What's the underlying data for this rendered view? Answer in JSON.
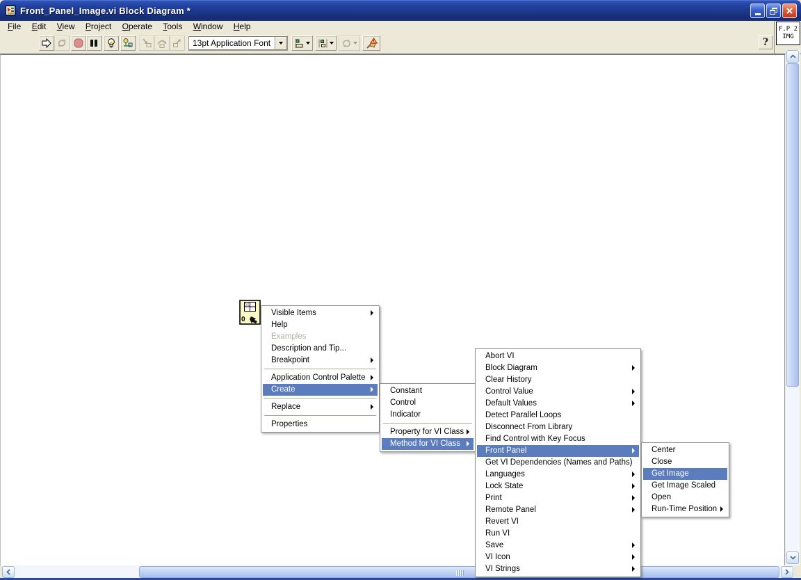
{
  "window": {
    "title": "Front_Panel_Image.vi Block Diagram *"
  },
  "vi_icon": {
    "line1": "F.P 2",
    "line2": "IMG"
  },
  "menu_bar": {
    "items": [
      {
        "label": "File"
      },
      {
        "label": "Edit"
      },
      {
        "label": "View"
      },
      {
        "label": "Project"
      },
      {
        "label": "Operate"
      },
      {
        "label": "Tools"
      },
      {
        "label": "Window"
      },
      {
        "label": "Help"
      }
    ]
  },
  "toolbar": {
    "font_selector": {
      "value": "13pt Application Font"
    },
    "buttons": [
      {
        "name": "run"
      },
      {
        "name": "run-continuously",
        "disabled": true
      },
      {
        "name": "abort-execution",
        "disabled": true
      },
      {
        "name": "pause"
      },
      {
        "name": "highlight-execution"
      },
      {
        "name": "retain-wire-values"
      },
      {
        "name": "step-into",
        "disabled": true
      },
      {
        "name": "step-over",
        "disabled": true
      },
      {
        "name": "step-out",
        "disabled": true
      },
      {
        "name": "align-objects"
      },
      {
        "name": "distribute-objects"
      },
      {
        "name": "reorder-objects",
        "disabled": true
      },
      {
        "name": "clean-up-diagram"
      },
      {
        "name": "context-help"
      }
    ]
  },
  "canvas": {
    "node": {
      "type": "vi-reference-invoke-node",
      "label": "0"
    }
  },
  "menus": {
    "node_context": {
      "items": [
        {
          "label": "Visible Items",
          "submenu": true
        },
        {
          "label": "Help"
        },
        {
          "label": "Examples",
          "disabled": true
        },
        {
          "label": "Description and Tip..."
        },
        {
          "label": "Breakpoint",
          "submenu": true
        },
        {
          "type": "separator"
        },
        {
          "label": "Application Control Palette",
          "submenu": true
        },
        {
          "label": "Create",
          "submenu": true,
          "highlighted": true
        },
        {
          "type": "separator"
        },
        {
          "label": "Replace",
          "submenu": true
        },
        {
          "type": "separator"
        },
        {
          "label": "Properties"
        }
      ]
    },
    "create_submenu": {
      "items": [
        {
          "label": "Constant"
        },
        {
          "label": "Control"
        },
        {
          "label": "Indicator"
        },
        {
          "type": "separator"
        },
        {
          "label": "Property for VI Class",
          "submenu": true
        },
        {
          "label": "Method for VI Class",
          "submenu": true,
          "highlighted": true
        }
      ]
    },
    "method_submenu": {
      "items": [
        {
          "label": "Abort VI"
        },
        {
          "label": "Block Diagram",
          "submenu": true
        },
        {
          "label": "Clear History"
        },
        {
          "label": "Control Value",
          "submenu": true
        },
        {
          "label": "Default Values",
          "submenu": true
        },
        {
          "label": "Detect Parallel Loops"
        },
        {
          "label": "Disconnect From Library"
        },
        {
          "label": "Find Control with Key Focus"
        },
        {
          "label": "Front Panel",
          "submenu": true,
          "highlighted": true
        },
        {
          "label": "Get VI Dependencies (Names and Paths)"
        },
        {
          "label": "Languages",
          "submenu": true
        },
        {
          "label": "Lock State",
          "submenu": true
        },
        {
          "label": "Print",
          "submenu": true
        },
        {
          "label": "Remote Panel",
          "submenu": true
        },
        {
          "label": "Revert VI"
        },
        {
          "label": "Run VI"
        },
        {
          "label": "Save",
          "submenu": true
        },
        {
          "label": "VI Icon",
          "submenu": true
        },
        {
          "label": "VI Strings",
          "submenu": true
        }
      ]
    },
    "front_panel_submenu": {
      "items": [
        {
          "label": "Center"
        },
        {
          "label": "Close"
        },
        {
          "label": "Get Image",
          "highlighted": true
        },
        {
          "label": "Get Image Scaled"
        },
        {
          "label": "Open"
        },
        {
          "label": "Run-Time Position",
          "submenu": true
        }
      ]
    }
  },
  "colors": {
    "menu_highlight": "#5b7dbe",
    "chrome_bg": "#ece9d8",
    "titlebar_top": "#2c51b4",
    "titlebar_bottom": "#152b70",
    "close_button": "#c03a1d",
    "menu_disabled_text": "#b2afa2",
    "canvas_bg": "#ffffff"
  }
}
